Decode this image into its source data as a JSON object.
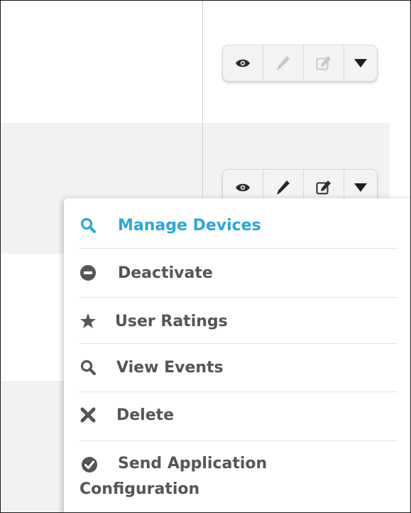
{
  "rows": [
    {
      "actions": {
        "view_icon": "eye-icon",
        "edit_icon": "pencil-icon",
        "edit_form_icon": "edit-square-icon",
        "dropdown_icon": "caret-down-icon",
        "state": "inactive"
      }
    },
    {
      "actions": {
        "view_icon": "eye-icon",
        "edit_icon": "pencil-icon",
        "edit_form_icon": "edit-square-icon",
        "dropdown_icon": "caret-down-icon",
        "state": "active"
      }
    }
  ],
  "dropdown_menu": {
    "items": [
      {
        "label": "Manage Devices",
        "icon": "search-icon",
        "active": true
      },
      {
        "label": "Deactivate",
        "icon": "minus-circle-icon"
      },
      {
        "label": "User Ratings",
        "icon": "star-icon"
      },
      {
        "label": "View Events",
        "icon": "search-icon"
      },
      {
        "label": "Delete",
        "icon": "x-icon"
      },
      {
        "label_line1": "Send Application",
        "label_line2": "Configuration",
        "icon": "check-circle-icon"
      }
    ]
  },
  "colors": {
    "accent": "#2aa6dc",
    "menu_text": "#555555",
    "row_band": "#f2f2f2"
  }
}
